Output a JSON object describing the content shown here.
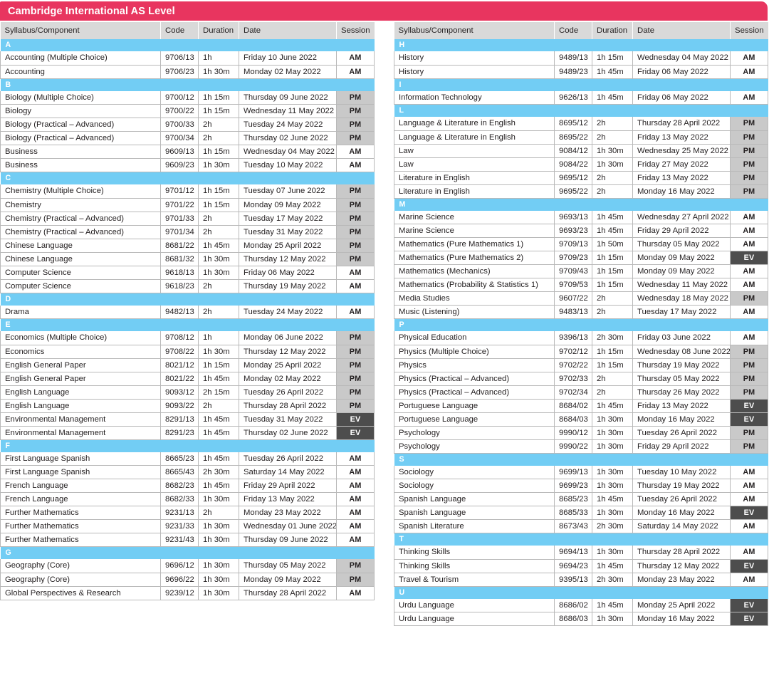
{
  "title": "Cambridge International AS Level",
  "columns": [
    "Syllabus/Component",
    "Code",
    "Duration",
    "Date",
    "Session"
  ],
  "colors": {
    "title_bar": "#e8355f",
    "section_bar": "#72cdf4",
    "header_row": "#d9d9d9",
    "session_pm": "#c9c9c9",
    "session_ev": "#4d4d4d",
    "grid_line": "#b9b9b9"
  },
  "session_codes": [
    "AM",
    "PM",
    "EV"
  ],
  "left_column": [
    {
      "letter": "A",
      "rows": [
        {
          "syllabus": "Accounting (Multiple Choice)",
          "code": "9706/13",
          "duration": "1h",
          "date": "Friday 10 June 2022",
          "session": "AM"
        },
        {
          "syllabus": "Accounting",
          "code": "9706/23",
          "duration": "1h 30m",
          "date": "Monday 02 May 2022",
          "session": "AM"
        }
      ]
    },
    {
      "letter": "B",
      "rows": [
        {
          "syllabus": "Biology (Multiple Choice)",
          "code": "9700/12",
          "duration": "1h 15m",
          "date": "Thursday 09 June 2022",
          "session": "PM"
        },
        {
          "syllabus": "Biology",
          "code": "9700/22",
          "duration": "1h 15m",
          "date": "Wednesday 11 May 2022",
          "session": "PM"
        },
        {
          "syllabus": "Biology (Practical – Advanced)",
          "code": "9700/33",
          "duration": "2h",
          "date": "Tuesday 24 May 2022",
          "session": "PM"
        },
        {
          "syllabus": "Biology (Practical – Advanced)",
          "code": "9700/34",
          "duration": "2h",
          "date": "Thursday 02 June 2022",
          "session": "PM"
        },
        {
          "syllabus": "Business",
          "code": "9609/13",
          "duration": "1h 15m",
          "date": "Wednesday 04 May 2022",
          "session": "AM"
        },
        {
          "syllabus": "Business",
          "code": "9609/23",
          "duration": "1h 30m",
          "date": "Tuesday 10 May 2022",
          "session": "AM"
        }
      ]
    },
    {
      "letter": "C",
      "rows": [
        {
          "syllabus": "Chemistry (Multiple Choice)",
          "code": "9701/12",
          "duration": "1h 15m",
          "date": "Tuesday 07 June 2022",
          "session": "PM"
        },
        {
          "syllabus": "Chemistry",
          "code": "9701/22",
          "duration": "1h 15m",
          "date": "Monday 09 May 2022",
          "session": "PM"
        },
        {
          "syllabus": "Chemistry (Practical – Advanced)",
          "code": "9701/33",
          "duration": "2h",
          "date": "Tuesday 17 May 2022",
          "session": "PM"
        },
        {
          "syllabus": "Chemistry (Practical – Advanced)",
          "code": "9701/34",
          "duration": "2h",
          "date": "Tuesday 31 May 2022",
          "session": "PM"
        },
        {
          "syllabus": "Chinese Language",
          "code": "8681/22",
          "duration": "1h 45m",
          "date": "Monday 25 April 2022",
          "session": "PM"
        },
        {
          "syllabus": "Chinese Language",
          "code": "8681/32",
          "duration": "1h 30m",
          "date": "Thursday 12 May 2022",
          "session": "PM"
        },
        {
          "syllabus": "Computer Science",
          "code": "9618/13",
          "duration": "1h 30m",
          "date": "Friday 06 May 2022",
          "session": "AM"
        },
        {
          "syllabus": "Computer Science",
          "code": "9618/23",
          "duration": "2h",
          "date": "Thursday 19 May 2022",
          "session": "AM"
        }
      ]
    },
    {
      "letter": "D",
      "rows": [
        {
          "syllabus": "Drama",
          "code": "9482/13",
          "duration": "2h",
          "date": "Tuesday 24 May 2022",
          "session": "AM"
        }
      ]
    },
    {
      "letter": "E",
      "rows": [
        {
          "syllabus": "Economics (Multiple Choice)",
          "code": "9708/12",
          "duration": "1h",
          "date": "Monday 06 June 2022",
          "session": "PM"
        },
        {
          "syllabus": "Economics",
          "code": "9708/22",
          "duration": "1h 30m",
          "date": "Thursday 12 May 2022",
          "session": "PM"
        },
        {
          "syllabus": "English General Paper",
          "code": "8021/12",
          "duration": "1h 15m",
          "date": "Monday 25 April 2022",
          "session": "PM"
        },
        {
          "syllabus": "English General Paper",
          "code": "8021/22",
          "duration": "1h 45m",
          "date": "Monday 02 May 2022",
          "session": "PM"
        },
        {
          "syllabus": "English Language",
          "code": "9093/12",
          "duration": "2h 15m",
          "date": "Tuesday 26 April 2022",
          "session": "PM"
        },
        {
          "syllabus": "English Language",
          "code": "9093/22",
          "duration": "2h",
          "date": "Thursday 28 April 2022",
          "session": "PM"
        },
        {
          "syllabus": "Environmental Management",
          "code": "8291/13",
          "duration": "1h 45m",
          "date": "Tuesday 31 May 2022",
          "session": "EV"
        },
        {
          "syllabus": "Environmental Management",
          "code": "8291/23",
          "duration": "1h 45m",
          "date": "Thursday 02 June 2022",
          "session": "EV"
        }
      ]
    },
    {
      "letter": "F",
      "rows": [
        {
          "syllabus": "First Language Spanish",
          "code": "8665/23",
          "duration": "1h 45m",
          "date": "Tuesday 26 April 2022",
          "session": "AM"
        },
        {
          "syllabus": "First Language Spanish",
          "code": "8665/43",
          "duration": "2h 30m",
          "date": "Saturday 14 May 2022",
          "session": "AM"
        },
        {
          "syllabus": "French Language",
          "code": "8682/23",
          "duration": "1h 45m",
          "date": "Friday 29 April 2022",
          "session": "AM"
        },
        {
          "syllabus": "French Language",
          "code": "8682/33",
          "duration": "1h 30m",
          "date": "Friday 13 May 2022",
          "session": "AM"
        },
        {
          "syllabus": "Further Mathematics",
          "code": "9231/13",
          "duration": "2h",
          "date": "Monday 23 May 2022",
          "session": "AM"
        },
        {
          "syllabus": "Further Mathematics",
          "code": "9231/33",
          "duration": "1h 30m",
          "date": "Wednesday 01 June 2022",
          "session": "AM"
        },
        {
          "syllabus": "Further Mathematics",
          "code": "9231/43",
          "duration": "1h 30m",
          "date": "Thursday 09 June 2022",
          "session": "AM"
        }
      ]
    },
    {
      "letter": "G",
      "rows": [
        {
          "syllabus": "Geography (Core)",
          "code": "9696/12",
          "duration": "1h 30m",
          "date": "Thursday 05 May 2022",
          "session": "PM"
        },
        {
          "syllabus": "Geography (Core)",
          "code": "9696/22",
          "duration": "1h 30m",
          "date": "Monday 09 May 2022",
          "session": "PM"
        },
        {
          "syllabus": "Global Perspectives & Research",
          "code": "9239/12",
          "duration": "1h 30m",
          "date": "Thursday 28 April 2022",
          "session": "AM"
        }
      ]
    }
  ],
  "right_column": [
    {
      "letter": "H",
      "rows": [
        {
          "syllabus": "History",
          "code": "9489/13",
          "duration": "1h 15m",
          "date": "Wednesday 04 May 2022",
          "session": "AM"
        },
        {
          "syllabus": "History",
          "code": "9489/23",
          "duration": "1h 45m",
          "date": "Friday 06 May 2022",
          "session": "AM"
        }
      ]
    },
    {
      "letter": "I",
      "rows": [
        {
          "syllabus": "Information Technology",
          "code": "9626/13",
          "duration": "1h 45m",
          "date": "Friday 06 May 2022",
          "session": "AM"
        }
      ]
    },
    {
      "letter": "L",
      "rows": [
        {
          "syllabus": "Language & Literature in English",
          "code": "8695/12",
          "duration": "2h",
          "date": "Thursday 28 April 2022",
          "session": "PM"
        },
        {
          "syllabus": "Language & Literature in English",
          "code": "8695/22",
          "duration": "2h",
          "date": "Friday 13 May 2022",
          "session": "PM"
        },
        {
          "syllabus": "Law",
          "code": "9084/12",
          "duration": "1h 30m",
          "date": "Wednesday 25 May 2022",
          "session": "PM"
        },
        {
          "syllabus": "Law",
          "code": "9084/22",
          "duration": "1h 30m",
          "date": "Friday 27 May 2022",
          "session": "PM"
        },
        {
          "syllabus": "Literature in English",
          "code": "9695/12",
          "duration": "2h",
          "date": "Friday 13 May 2022",
          "session": "PM"
        },
        {
          "syllabus": "Literature in English",
          "code": "9695/22",
          "duration": "2h",
          "date": "Monday 16 May 2022",
          "session": "PM"
        }
      ]
    },
    {
      "letter": "M",
      "rows": [
        {
          "syllabus": "Marine Science",
          "code": "9693/13",
          "duration": "1h 45m",
          "date": "Wednesday 27 April 2022",
          "session": "AM"
        },
        {
          "syllabus": "Marine Science",
          "code": "9693/23",
          "duration": "1h 45m",
          "date": "Friday 29 April 2022",
          "session": "AM"
        },
        {
          "syllabus": "Mathematics (Pure Mathematics 1)",
          "code": "9709/13",
          "duration": "1h 50m",
          "date": "Thursday 05 May 2022",
          "session": "AM"
        },
        {
          "syllabus": "Mathematics (Pure Mathematics 2)",
          "code": "9709/23",
          "duration": "1h 15m",
          "date": "Monday 09 May 2022",
          "session": "EV"
        },
        {
          "syllabus": "Mathematics (Mechanics)",
          "code": "9709/43",
          "duration": "1h 15m",
          "date": "Monday 09 May 2022",
          "session": "AM"
        },
        {
          "syllabus": "Mathematics (Probability & Statistics 1)",
          "code": "9709/53",
          "duration": "1h 15m",
          "date": "Wednesday 11 May 2022",
          "session": "AM"
        },
        {
          "syllabus": "Media Studies",
          "code": "9607/22",
          "duration": "2h",
          "date": "Wednesday 18 May 2022",
          "session": "PM"
        },
        {
          "syllabus": "Music (Listening)",
          "code": "9483/13",
          "duration": "2h",
          "date": "Tuesday 17 May 2022",
          "session": "AM"
        }
      ]
    },
    {
      "letter": "P",
      "rows": [
        {
          "syllabus": "Physical Education",
          "code": "9396/13",
          "duration": "2h 30m",
          "date": "Friday 03 June 2022",
          "session": "AM"
        },
        {
          "syllabus": "Physics (Multiple Choice)",
          "code": "9702/12",
          "duration": "1h 15m",
          "date": "Wednesday 08 June 2022",
          "session": "PM"
        },
        {
          "syllabus": "Physics",
          "code": "9702/22",
          "duration": "1h 15m",
          "date": "Thursday 19 May 2022",
          "session": "PM"
        },
        {
          "syllabus": "Physics (Practical – Advanced)",
          "code": "9702/33",
          "duration": "2h",
          "date": "Thursday 05 May 2022",
          "session": "PM"
        },
        {
          "syllabus": "Physics (Practical – Advanced)",
          "code": "9702/34",
          "duration": "2h",
          "date": "Thursday 26 May 2022",
          "session": "PM"
        },
        {
          "syllabus": "Portuguese Language",
          "code": "8684/02",
          "duration": "1h 45m",
          "date": "Friday 13 May 2022",
          "session": "EV"
        },
        {
          "syllabus": "Portuguese Language",
          "code": "8684/03",
          "duration": "1h 30m",
          "date": "Monday 16 May 2022",
          "session": "EV"
        },
        {
          "syllabus": "Psychology",
          "code": "9990/12",
          "duration": "1h 30m",
          "date": "Tuesday 26 April 2022",
          "session": "PM"
        },
        {
          "syllabus": "Psychology",
          "code": "9990/22",
          "duration": "1h 30m",
          "date": "Friday 29 April 2022",
          "session": "PM"
        }
      ]
    },
    {
      "letter": "S",
      "rows": [
        {
          "syllabus": "Sociology",
          "code": "9699/13",
          "duration": "1h 30m",
          "date": "Tuesday 10 May 2022",
          "session": "AM"
        },
        {
          "syllabus": "Sociology",
          "code": "9699/23",
          "duration": "1h 30m",
          "date": "Thursday 19 May 2022",
          "session": "AM"
        },
        {
          "syllabus": "Spanish Language",
          "code": "8685/23",
          "duration": "1h 45m",
          "date": "Tuesday 26 April 2022",
          "session": "AM"
        },
        {
          "syllabus": "Spanish Language",
          "code": "8685/33",
          "duration": "1h 30m",
          "date": "Monday 16 May 2022",
          "session": "EV"
        },
        {
          "syllabus": "Spanish Literature",
          "code": "8673/43",
          "duration": "2h 30m",
          "date": "Saturday 14 May 2022",
          "session": "AM"
        }
      ]
    },
    {
      "letter": "T",
      "rows": [
        {
          "syllabus": "Thinking Skills",
          "code": "9694/13",
          "duration": "1h 30m",
          "date": "Thursday 28 April 2022",
          "session": "AM"
        },
        {
          "syllabus": "Thinking Skills",
          "code": "9694/23",
          "duration": "1h 45m",
          "date": "Thursday 12 May 2022",
          "session": "EV"
        },
        {
          "syllabus": "Travel & Tourism",
          "code": "9395/13",
          "duration": "2h 30m",
          "date": "Monday 23 May 2022",
          "session": "AM"
        }
      ]
    },
    {
      "letter": "U",
      "rows": [
        {
          "syllabus": "Urdu Language",
          "code": "8686/02",
          "duration": "1h 45m",
          "date": "Monday 25 April 2022",
          "session": "EV"
        },
        {
          "syllabus": "Urdu Language",
          "code": "8686/03",
          "duration": "1h 30m",
          "date": "Monday 16 May 2022",
          "session": "EV"
        }
      ]
    }
  ]
}
